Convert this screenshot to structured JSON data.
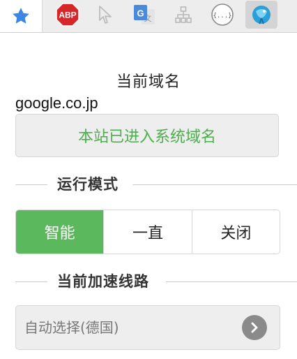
{
  "toolbar": {
    "extensions": [
      {
        "name": "star-icon"
      },
      {
        "name": "adblock-plus-icon",
        "label": "ABP"
      },
      {
        "name": "cursor-arrow-icon"
      },
      {
        "name": "google-translate-icon",
        "label": "G"
      },
      {
        "name": "sitemap-icon"
      },
      {
        "name": "json-braces-icon",
        "label": "{...}"
      },
      {
        "name": "proxy-extension-icon"
      }
    ]
  },
  "popup": {
    "title": "当前域名",
    "domain": "google.co.jp",
    "status": "本站已进入系统域名",
    "status_color": "#4cae4c",
    "mode_section": {
      "label": "运行模式",
      "options": [
        "智能",
        "一直",
        "关闭"
      ],
      "selected": "智能",
      "selected_color": "#5cb85c"
    },
    "route_section": {
      "label": "当前加速线路",
      "value": "自动选择(德国)"
    }
  }
}
